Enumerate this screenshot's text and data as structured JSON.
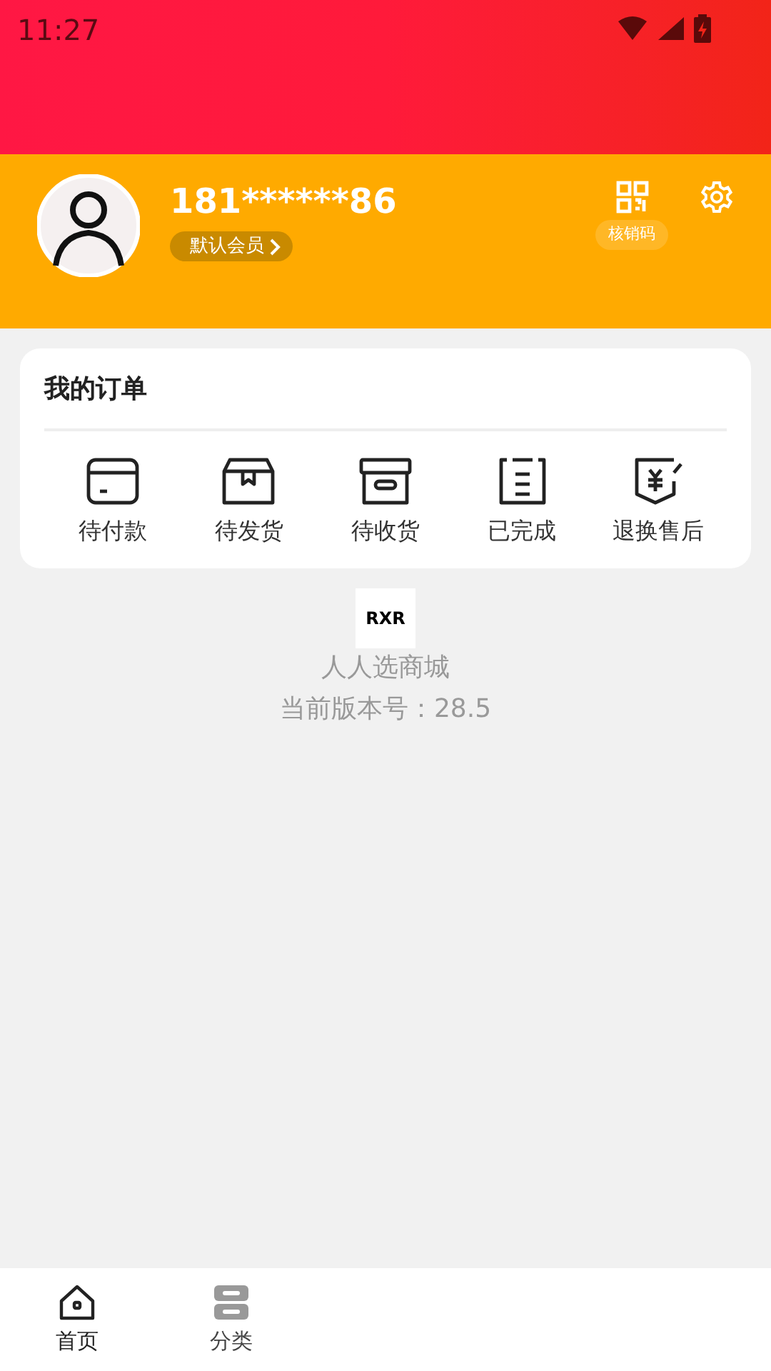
{
  "status_bar": {
    "time": "11:27"
  },
  "profile": {
    "phone": "181******86",
    "member_level": "默认会员",
    "verify_code_label": "核销码"
  },
  "orders": {
    "title": "我的订单",
    "items": [
      {
        "kind": "card",
        "label": "待付款"
      },
      {
        "kind": "box",
        "label": "待发货"
      },
      {
        "kind": "archive",
        "label": "待收货"
      },
      {
        "kind": "list",
        "label": "已完成"
      },
      {
        "kind": "refund",
        "label": "退换售后"
      }
    ]
  },
  "about": {
    "logo": "RXR",
    "app_name": "人人选商城",
    "version": "当前版本号：28.5"
  },
  "bottom_nav": [
    {
      "kind": "home",
      "label": "首页",
      "selected": true
    },
    {
      "kind": "category",
      "label": "分类",
      "selected": false
    }
  ]
}
